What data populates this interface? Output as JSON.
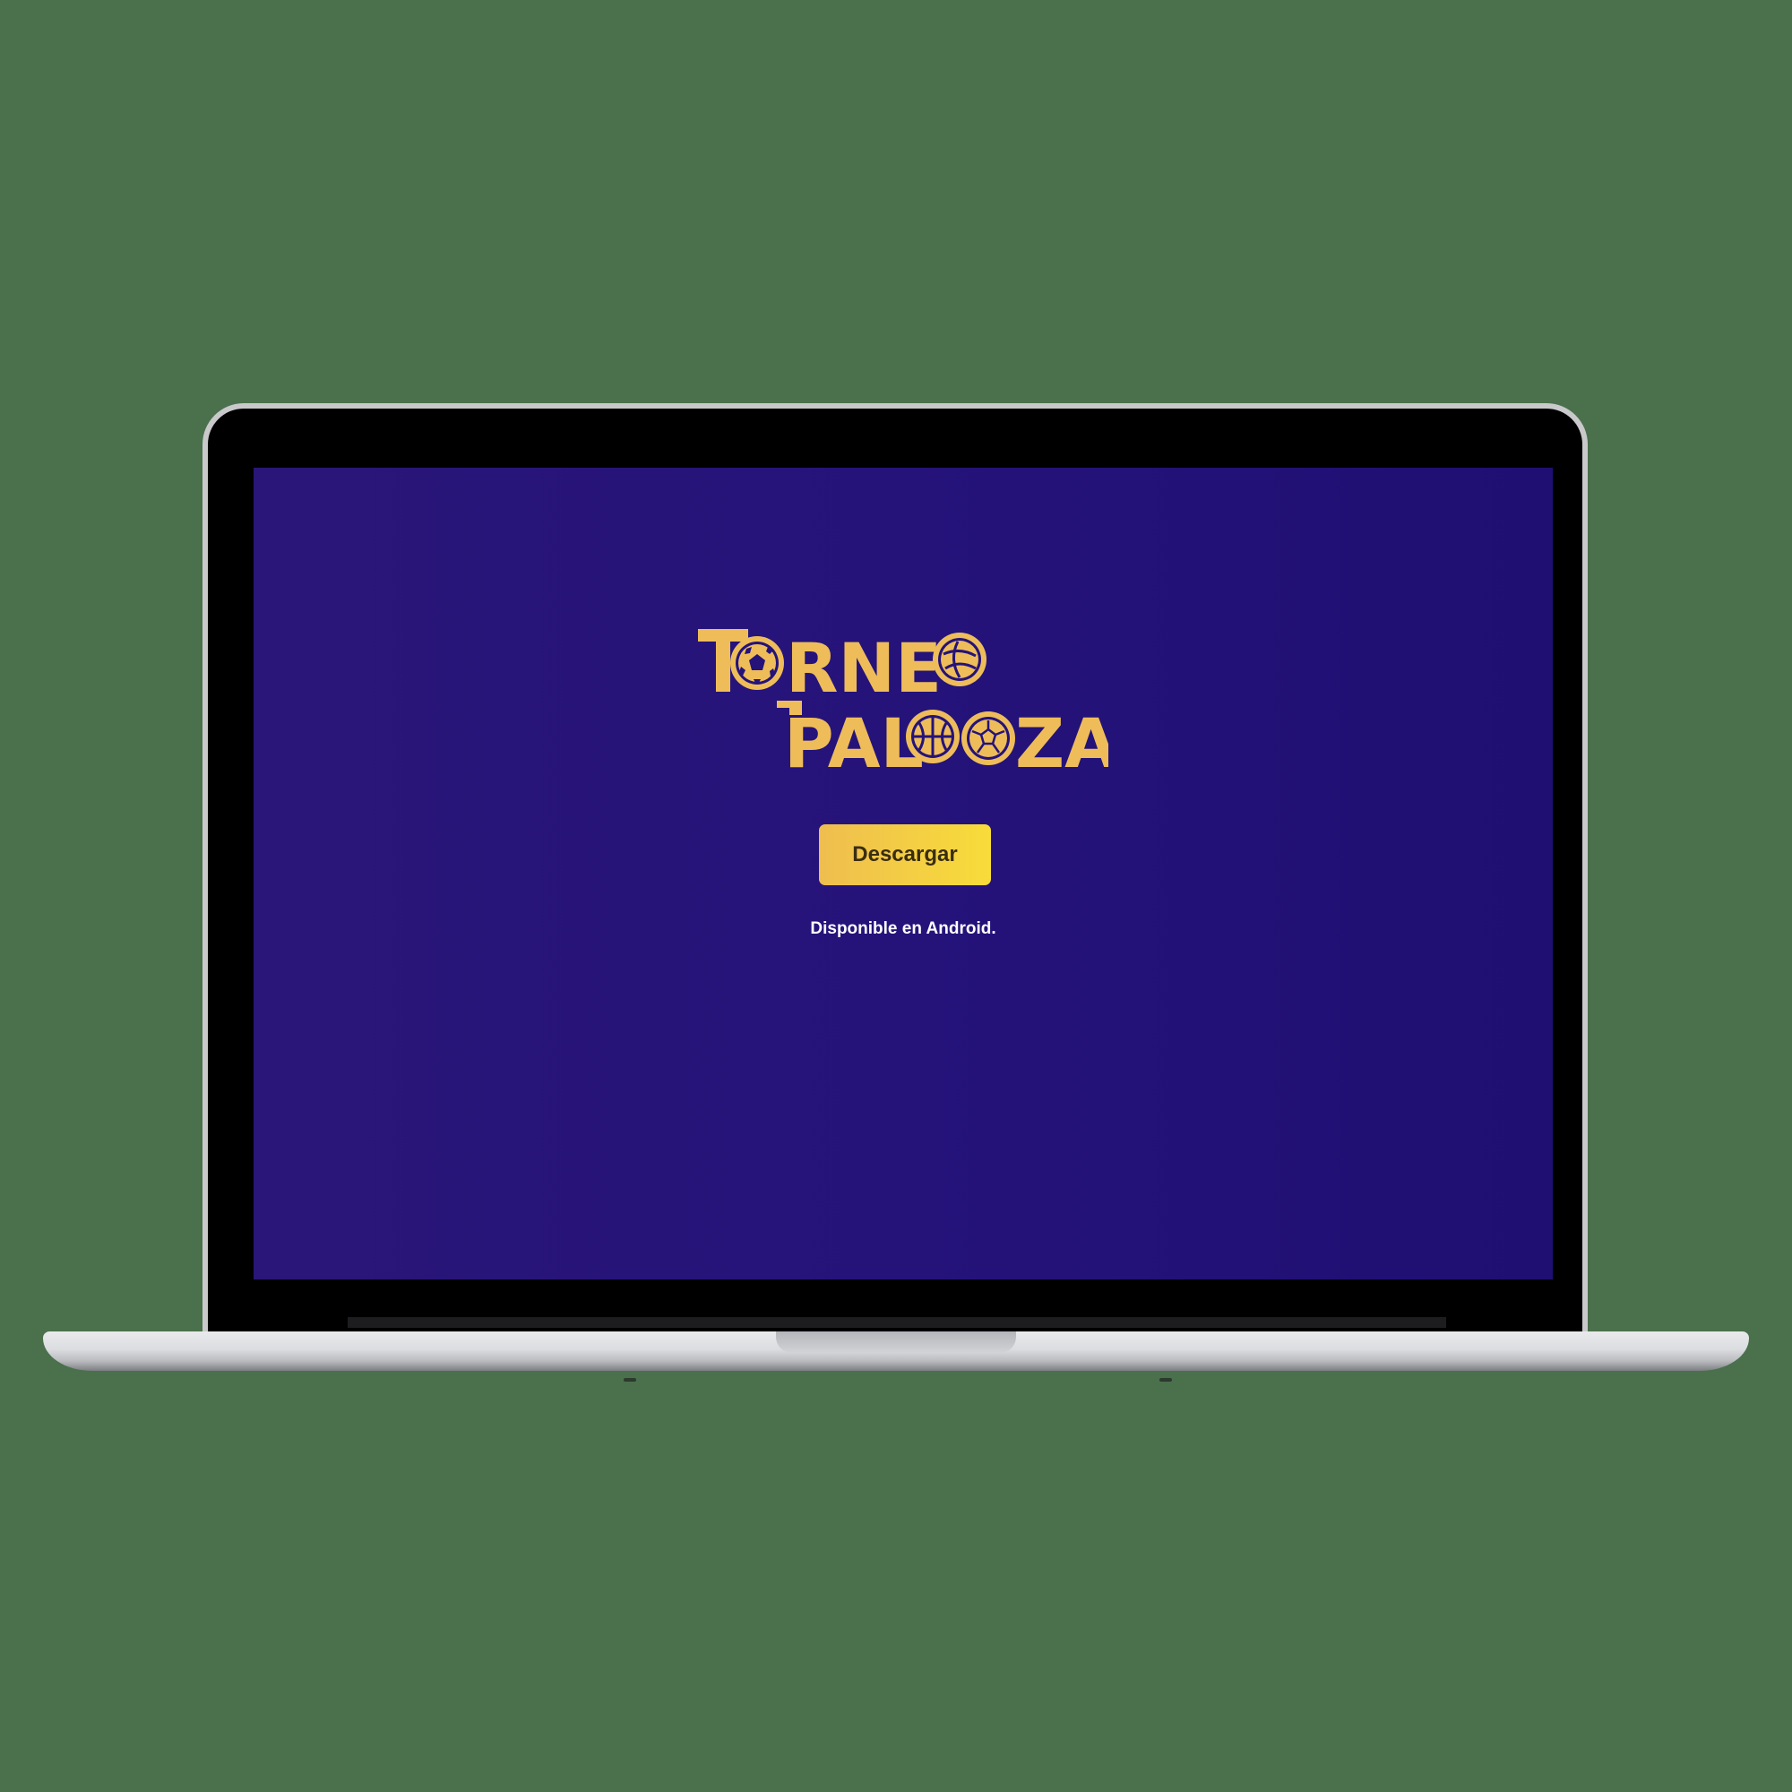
{
  "brand": {
    "logo_line1": "TORNEO",
    "logo_line2": "PALOOZA",
    "logo_color": "#eebd5a"
  },
  "screen": {
    "background_color": "#25137a",
    "download_button_label": "Descargar",
    "download_button_color": "#f3cb45",
    "availability_text": "Disponible en Android."
  },
  "icons": [
    "soccer-ball-icon",
    "volleyball-icon",
    "basketball-icon",
    "handball-icon"
  ]
}
